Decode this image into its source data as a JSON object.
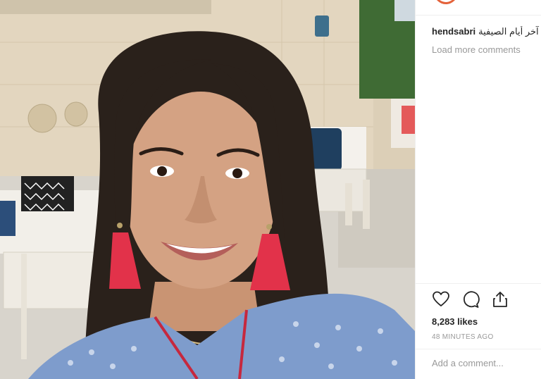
{
  "post": {
    "username": "hendsabri",
    "caption": "آخر أيام الصيفية",
    "load_more_label": "Load more comments",
    "likes": "8,283 likes",
    "time": "48 MINUTES AGO",
    "comment_placeholder": "Add a comment..."
  },
  "icons": {
    "like": "heart-icon",
    "comment": "comment-icon",
    "share": "share-icon"
  },
  "colors": {
    "avatar_ring": "#e4623a",
    "text": "#262626",
    "muted": "#999999"
  }
}
